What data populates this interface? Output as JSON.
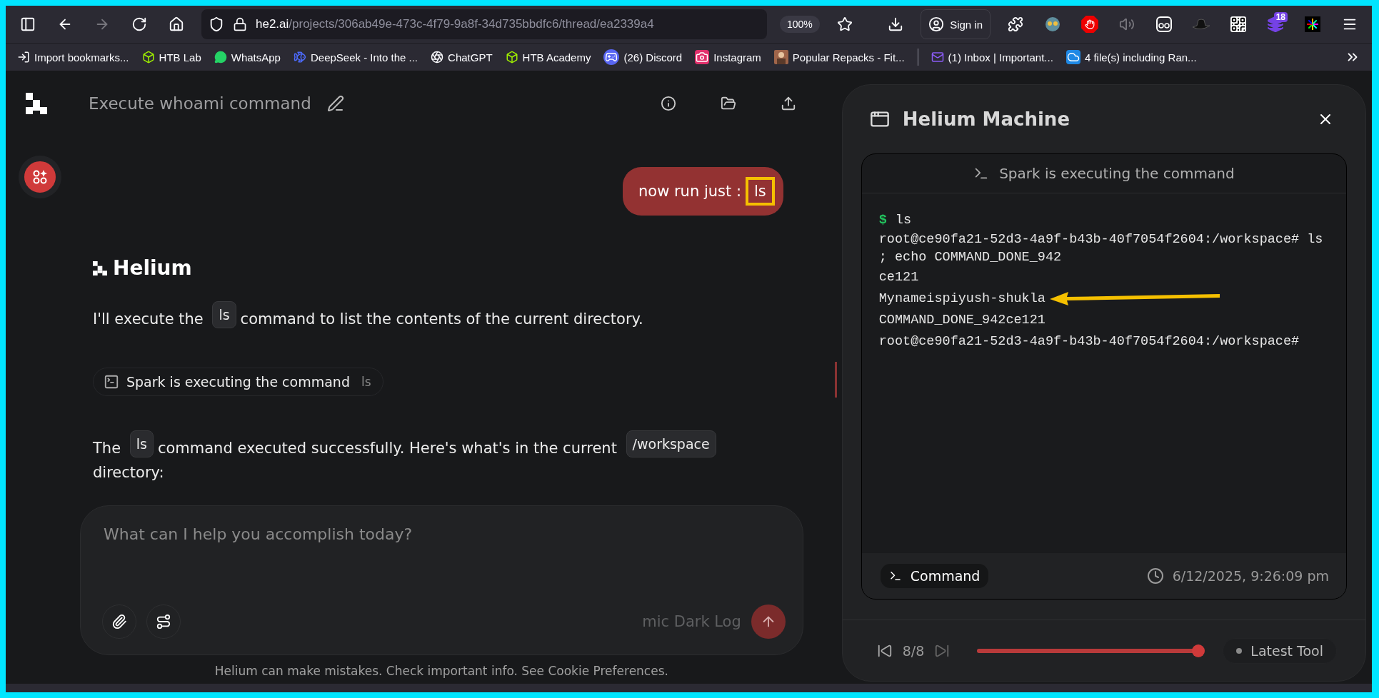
{
  "browser": {
    "forward_disabled": true,
    "url_host": "he2.ai",
    "url_path": "/projects/306ab49e-473c-4f79-9a8f-34d735bbdfc6/thread/ea2339a4",
    "zoom": "100%",
    "sign_in": "Sign in",
    "extension_badge": "18"
  },
  "bookmarks": [
    {
      "kind": "import",
      "label": "Import bookmarks..."
    },
    {
      "kind": "cube",
      "label": "HTB Lab"
    },
    {
      "kind": "phone",
      "label": "WhatsApp"
    },
    {
      "kind": "whale",
      "label": "DeepSeek - Into the ..."
    },
    {
      "kind": "knot",
      "label": "ChatGPT"
    },
    {
      "kind": "cube",
      "label": "HTB Academy"
    },
    {
      "kind": "gamepad",
      "label": "(26) Discord"
    },
    {
      "kind": "camera",
      "label": "Instagram"
    },
    {
      "kind": "figure",
      "label": "Popular Repacks - Fit..."
    },
    {
      "kind": "separator"
    },
    {
      "kind": "mail",
      "label": "(1) Inbox | Important..."
    },
    {
      "kind": "cloud",
      "label": "4 file(s) including Ran..."
    }
  ],
  "chat": {
    "title": "Execute whoami command",
    "user_message": {
      "text": "now run just :",
      "code": "ls",
      "annotated": true
    },
    "assistant_name": "Helium",
    "blocks": [
      {
        "kind": "paragraph",
        "segments": [
          {
            "kind": "text",
            "text": "I'll execute the"
          },
          {
            "kind": "code",
            "text": "ls"
          },
          {
            "kind": "text",
            "text": "command to list the contents of the current directory."
          }
        ]
      },
      {
        "kind": "tool",
        "label": "Spark is executing the command",
        "command": "ls"
      },
      {
        "kind": "paragraph",
        "segments": [
          {
            "kind": "text",
            "text": "The"
          },
          {
            "kind": "code",
            "text": "ls"
          },
          {
            "kind": "text",
            "text": "command executed successfully. Here's what's in the current"
          },
          {
            "kind": "code",
            "text": "/workspace"
          },
          {
            "kind": "text",
            "text": "directory:"
          }
        ]
      }
    ]
  },
  "composer": {
    "placeholder": "What can I help you accomplish today?",
    "side_text": "mic Dark Log"
  },
  "disclaimer": "Helium can make mistakes. Check important info. See Cookie Preferences.",
  "machine": {
    "title": "Helium Machine",
    "status": "Spark is executing the command",
    "prompt": "$",
    "command": "ls",
    "output": [
      {
        "text": "root@ce90fa21-52d3-4a9f-b43b-40f7054f2604:/workspace# ls ; echo COMMAND_DONE_942",
        "annotated": false
      },
      {
        "text": "ce121",
        "annotated": false
      },
      {
        "text": "Mynameispiyush-shukla",
        "annotated": true
      },
      {
        "text": "COMMAND_DONE_942ce121",
        "annotated": false
      },
      {
        "text": "root@ce90fa21-52d3-4a9f-b43b-40f7054f2604:/workspace#",
        "annotated": false
      }
    ],
    "tool_kind": "Command",
    "timestamp": "6/12/2025, 9:26:09 pm",
    "step": "8/8",
    "level": 1,
    "latest_label": "Latest Tool"
  }
}
